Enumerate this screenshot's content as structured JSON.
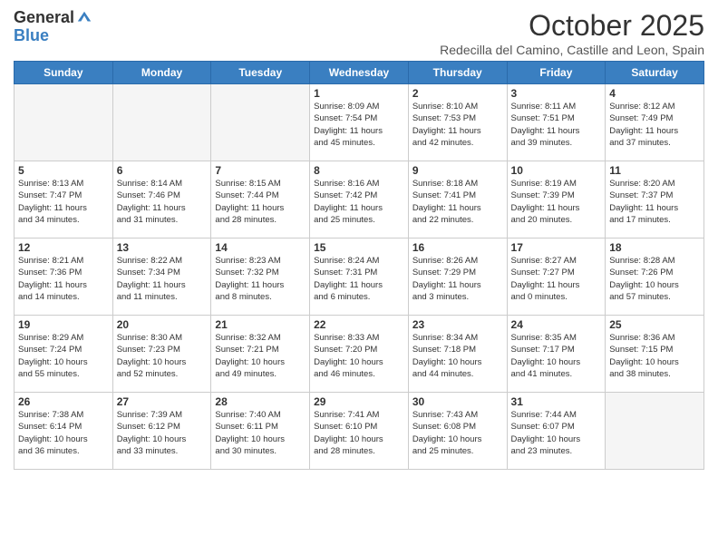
{
  "logo": {
    "general": "General",
    "blue": "Blue"
  },
  "header": {
    "title": "October 2025",
    "subtitle": "Redecilla del Camino, Castille and Leon, Spain"
  },
  "weekdays": [
    "Sunday",
    "Monday",
    "Tuesday",
    "Wednesday",
    "Thursday",
    "Friday",
    "Saturday"
  ],
  "weeks": [
    {
      "days": [
        {
          "num": "",
          "info": ""
        },
        {
          "num": "",
          "info": ""
        },
        {
          "num": "",
          "info": ""
        },
        {
          "num": "1",
          "info": "Sunrise: 8:09 AM\nSunset: 7:54 PM\nDaylight: 11 hours\nand 45 minutes."
        },
        {
          "num": "2",
          "info": "Sunrise: 8:10 AM\nSunset: 7:53 PM\nDaylight: 11 hours\nand 42 minutes."
        },
        {
          "num": "3",
          "info": "Sunrise: 8:11 AM\nSunset: 7:51 PM\nDaylight: 11 hours\nand 39 minutes."
        },
        {
          "num": "4",
          "info": "Sunrise: 8:12 AM\nSunset: 7:49 PM\nDaylight: 11 hours\nand 37 minutes."
        }
      ]
    },
    {
      "days": [
        {
          "num": "5",
          "info": "Sunrise: 8:13 AM\nSunset: 7:47 PM\nDaylight: 11 hours\nand 34 minutes."
        },
        {
          "num": "6",
          "info": "Sunrise: 8:14 AM\nSunset: 7:46 PM\nDaylight: 11 hours\nand 31 minutes."
        },
        {
          "num": "7",
          "info": "Sunrise: 8:15 AM\nSunset: 7:44 PM\nDaylight: 11 hours\nand 28 minutes."
        },
        {
          "num": "8",
          "info": "Sunrise: 8:16 AM\nSunset: 7:42 PM\nDaylight: 11 hours\nand 25 minutes."
        },
        {
          "num": "9",
          "info": "Sunrise: 8:18 AM\nSunset: 7:41 PM\nDaylight: 11 hours\nand 22 minutes."
        },
        {
          "num": "10",
          "info": "Sunrise: 8:19 AM\nSunset: 7:39 PM\nDaylight: 11 hours\nand 20 minutes."
        },
        {
          "num": "11",
          "info": "Sunrise: 8:20 AM\nSunset: 7:37 PM\nDaylight: 11 hours\nand 17 minutes."
        }
      ]
    },
    {
      "days": [
        {
          "num": "12",
          "info": "Sunrise: 8:21 AM\nSunset: 7:36 PM\nDaylight: 11 hours\nand 14 minutes."
        },
        {
          "num": "13",
          "info": "Sunrise: 8:22 AM\nSunset: 7:34 PM\nDaylight: 11 hours\nand 11 minutes."
        },
        {
          "num": "14",
          "info": "Sunrise: 8:23 AM\nSunset: 7:32 PM\nDaylight: 11 hours\nand 8 minutes."
        },
        {
          "num": "15",
          "info": "Sunrise: 8:24 AM\nSunset: 7:31 PM\nDaylight: 11 hours\nand 6 minutes."
        },
        {
          "num": "16",
          "info": "Sunrise: 8:26 AM\nSunset: 7:29 PM\nDaylight: 11 hours\nand 3 minutes."
        },
        {
          "num": "17",
          "info": "Sunrise: 8:27 AM\nSunset: 7:27 PM\nDaylight: 11 hours\nand 0 minutes."
        },
        {
          "num": "18",
          "info": "Sunrise: 8:28 AM\nSunset: 7:26 PM\nDaylight: 10 hours\nand 57 minutes."
        }
      ]
    },
    {
      "days": [
        {
          "num": "19",
          "info": "Sunrise: 8:29 AM\nSunset: 7:24 PM\nDaylight: 10 hours\nand 55 minutes."
        },
        {
          "num": "20",
          "info": "Sunrise: 8:30 AM\nSunset: 7:23 PM\nDaylight: 10 hours\nand 52 minutes."
        },
        {
          "num": "21",
          "info": "Sunrise: 8:32 AM\nSunset: 7:21 PM\nDaylight: 10 hours\nand 49 minutes."
        },
        {
          "num": "22",
          "info": "Sunrise: 8:33 AM\nSunset: 7:20 PM\nDaylight: 10 hours\nand 46 minutes."
        },
        {
          "num": "23",
          "info": "Sunrise: 8:34 AM\nSunset: 7:18 PM\nDaylight: 10 hours\nand 44 minutes."
        },
        {
          "num": "24",
          "info": "Sunrise: 8:35 AM\nSunset: 7:17 PM\nDaylight: 10 hours\nand 41 minutes."
        },
        {
          "num": "25",
          "info": "Sunrise: 8:36 AM\nSunset: 7:15 PM\nDaylight: 10 hours\nand 38 minutes."
        }
      ]
    },
    {
      "days": [
        {
          "num": "26",
          "info": "Sunrise: 7:38 AM\nSunset: 6:14 PM\nDaylight: 10 hours\nand 36 minutes."
        },
        {
          "num": "27",
          "info": "Sunrise: 7:39 AM\nSunset: 6:12 PM\nDaylight: 10 hours\nand 33 minutes."
        },
        {
          "num": "28",
          "info": "Sunrise: 7:40 AM\nSunset: 6:11 PM\nDaylight: 10 hours\nand 30 minutes."
        },
        {
          "num": "29",
          "info": "Sunrise: 7:41 AM\nSunset: 6:10 PM\nDaylight: 10 hours\nand 28 minutes."
        },
        {
          "num": "30",
          "info": "Sunrise: 7:43 AM\nSunset: 6:08 PM\nDaylight: 10 hours\nand 25 minutes."
        },
        {
          "num": "31",
          "info": "Sunrise: 7:44 AM\nSunset: 6:07 PM\nDaylight: 10 hours\nand 23 minutes."
        },
        {
          "num": "",
          "info": ""
        }
      ]
    }
  ]
}
